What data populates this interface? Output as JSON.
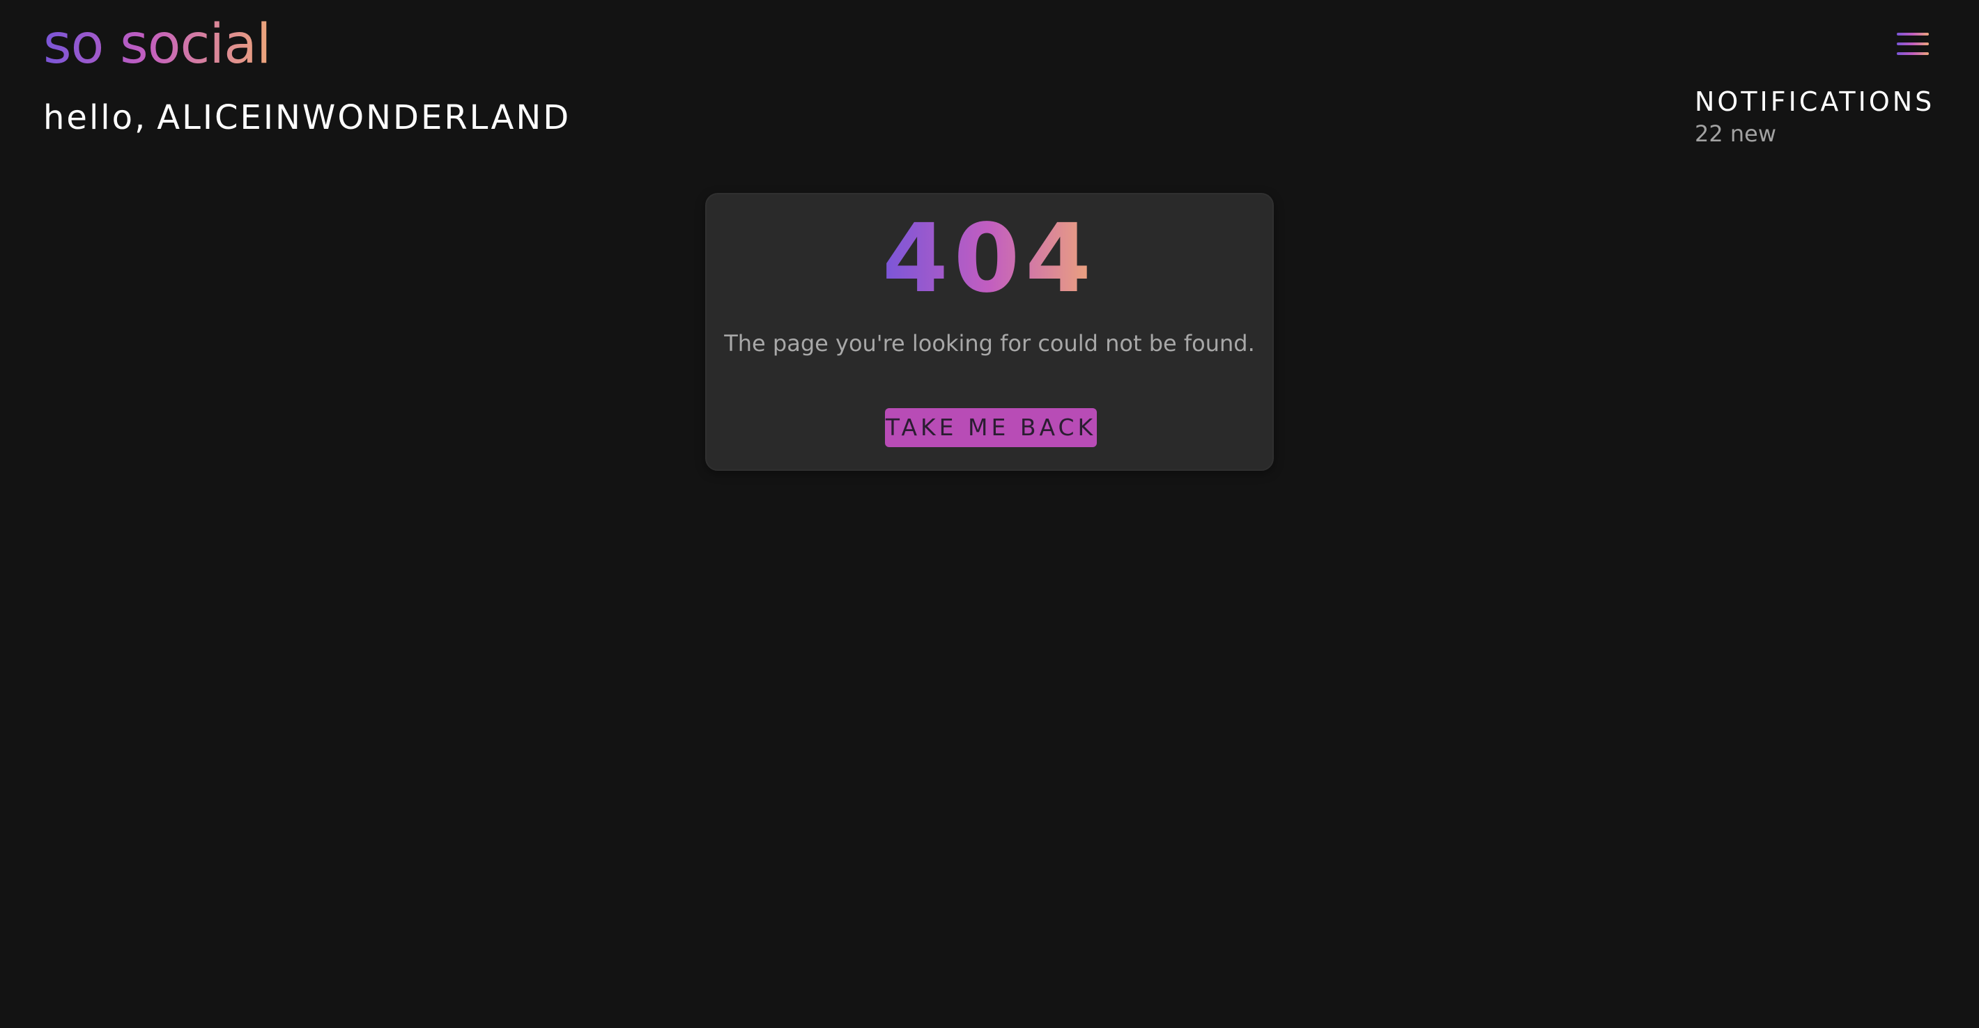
{
  "header": {
    "brand": "so social",
    "greeting_prefix": "hello,",
    "username": "ALICEINWONDERLAND",
    "menu_icon": "hamburger-menu-icon"
  },
  "notifications": {
    "title": "NOTIFICATIONS",
    "count_text": "22 new"
  },
  "error_card": {
    "code": "404",
    "message": "The page you're looking for could not be found.",
    "back_button_label": "TAKE ME BACK"
  },
  "colors": {
    "background": "#131313",
    "card": "#2a2a2a",
    "accent": "#b84cb6",
    "gradient_start": "#7a56d8",
    "gradient_mid": "#c25ec0",
    "gradient_end": "#eda67a"
  }
}
